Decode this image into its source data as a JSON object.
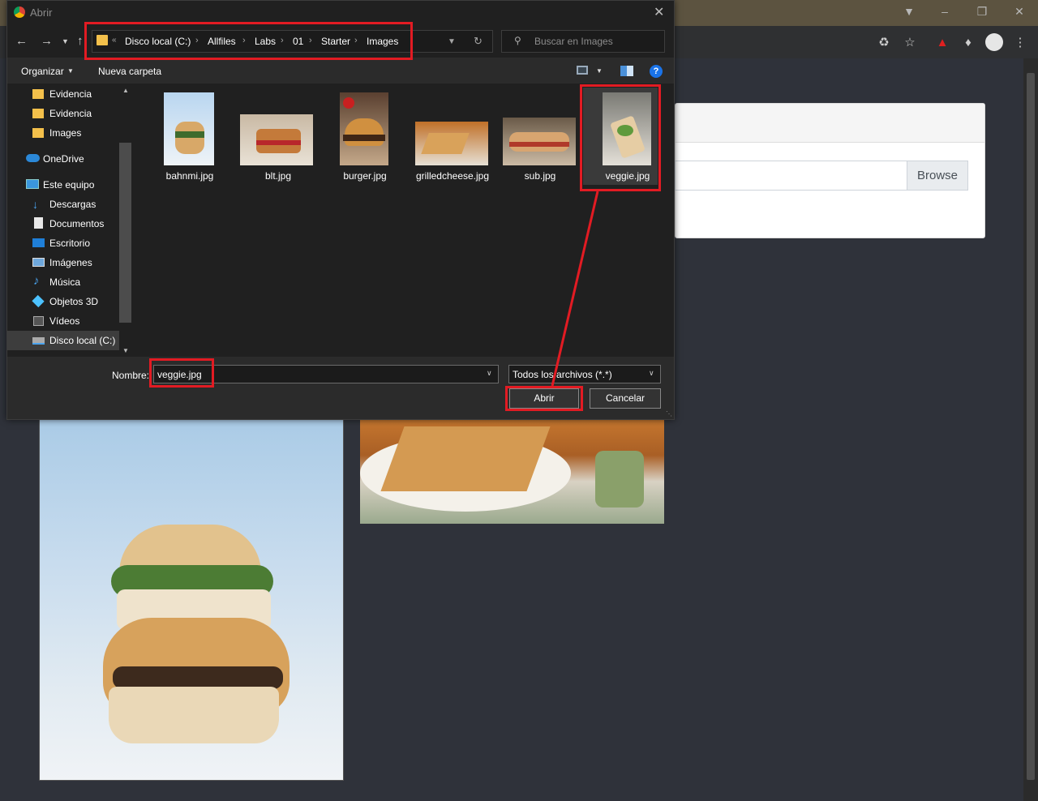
{
  "dialog": {
    "title": "Abrir",
    "breadcrumb": [
      "Disco local (C:)",
      "Allfiles",
      "Labs",
      "01",
      "Starter",
      "Images"
    ],
    "search_placeholder": "Buscar en Images",
    "toolbar": {
      "organize": "Organizar",
      "new_folder": "Nueva carpeta"
    },
    "sidebar": [
      {
        "label": "Evidencia",
        "icon": "folder-icon"
      },
      {
        "label": "Evidencia",
        "icon": "folder-icon"
      },
      {
        "label": "Images",
        "icon": "folder-icon"
      },
      {
        "label": "OneDrive",
        "icon": "cloud-icon"
      },
      {
        "label": "Este equipo",
        "icon": "computer-icon"
      },
      {
        "label": "Descargas",
        "icon": "download-icon"
      },
      {
        "label": "Documentos",
        "icon": "document-icon"
      },
      {
        "label": "Escritorio",
        "icon": "desktop-icon"
      },
      {
        "label": "Imágenes",
        "icon": "pictures-icon"
      },
      {
        "label": "Música",
        "icon": "music-icon"
      },
      {
        "label": "Objetos 3D",
        "icon": "cube-icon"
      },
      {
        "label": "Vídeos",
        "icon": "video-icon"
      },
      {
        "label": "Disco local (C:)",
        "icon": "drive-icon"
      }
    ],
    "files": [
      "bahnmi.jpg",
      "blt.jpg",
      "burger.jpg",
      "grilledcheese.jpg",
      "sub.jpg",
      "veggie.jpg"
    ],
    "filename_label": "Nombre:",
    "filename_value": "veggie.jpg",
    "filter_value": "Todos los archivos (*.*)",
    "open_button": "Abrir",
    "cancel_button": "Cancelar"
  },
  "page": {
    "browse_button": "Browse"
  },
  "colors": {
    "annotation": "#e21b23",
    "dialog_bg": "#202020"
  }
}
